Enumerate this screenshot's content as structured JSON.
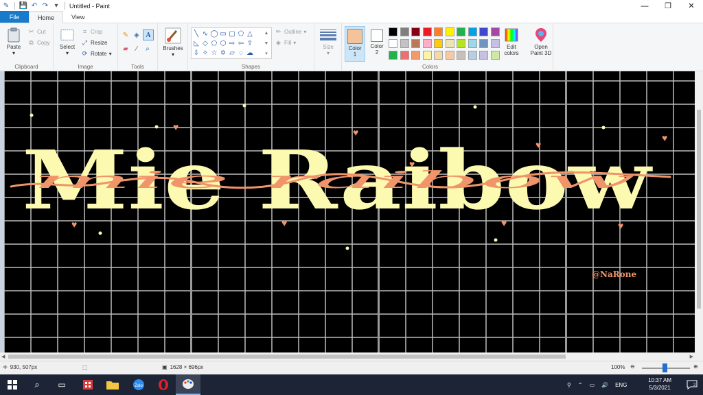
{
  "window": {
    "title": "Untitled - Paint",
    "controls": {
      "minimize": "—",
      "restore": "❐",
      "close": "✕"
    }
  },
  "tabs": [
    {
      "label": "File"
    },
    {
      "label": "Home"
    },
    {
      "label": "View"
    }
  ],
  "ribbon": {
    "clipboard": {
      "label": "Clipboard",
      "paste": "Paste",
      "cut": "Cut",
      "copy": "Copy"
    },
    "image": {
      "label": "Image",
      "select": "Select",
      "crop": "Crop",
      "resize": "Resize",
      "rotate": "Rotate"
    },
    "tools": {
      "label": "Tools"
    },
    "brushes": {
      "label": "Brushes"
    },
    "shapes": {
      "label": "Shapes",
      "outline": "Outline",
      "fill": "Fill"
    },
    "size": {
      "label": "Size"
    },
    "colors": {
      "label": "Colors",
      "color1": {
        "label": "Color",
        "index": "1",
        "value": "#f5c39a"
      },
      "color2": {
        "label": "Color",
        "index": "2",
        "value": "#ffffff"
      },
      "edit": "Edit colors",
      "edit_line1": "Edit",
      "edit_line2": "colors",
      "paint3d_line1": "Open",
      "paint3d_line2": "Paint 3D"
    },
    "palette_row1": [
      "#000000",
      "#7f7f7f",
      "#880015",
      "#ed1c24",
      "#ff7f27",
      "#fff200",
      "#22b14c",
      "#00a2e8",
      "#3f48cc",
      "#a349a4"
    ],
    "palette_row2": [
      "#ffffff",
      "#c3c3c3",
      "#b97a57",
      "#ffaec9",
      "#ffc90e",
      "#efe4b0",
      "#b5e61d",
      "#99d9ea",
      "#7092be",
      "#c8bfe7"
    ],
    "palette_row3": [
      "#22b14c",
      "#f06e6e",
      "#f39a6b",
      "#fff3a8",
      "#f4d9a8",
      "#f6c9a2",
      "#c8c0b8",
      "#b7cfe6",
      "#c8c0e0",
      "#d0e8a0"
    ]
  },
  "canvas": {
    "title_text": "Mie Raibow",
    "script_text": "mie raibow",
    "watermark": "@NaRone",
    "background": "#000000",
    "text_color": "#fcf9b0",
    "script_color": "#f0946a"
  },
  "status": {
    "cursor_pos": "930, 507px",
    "canvas_size": "1628 × 696px",
    "zoom": "100%"
  },
  "taskbar": {
    "lang": "ENG",
    "time": "10:37 AM",
    "date": "5/3/2021",
    "notifications": "2"
  }
}
